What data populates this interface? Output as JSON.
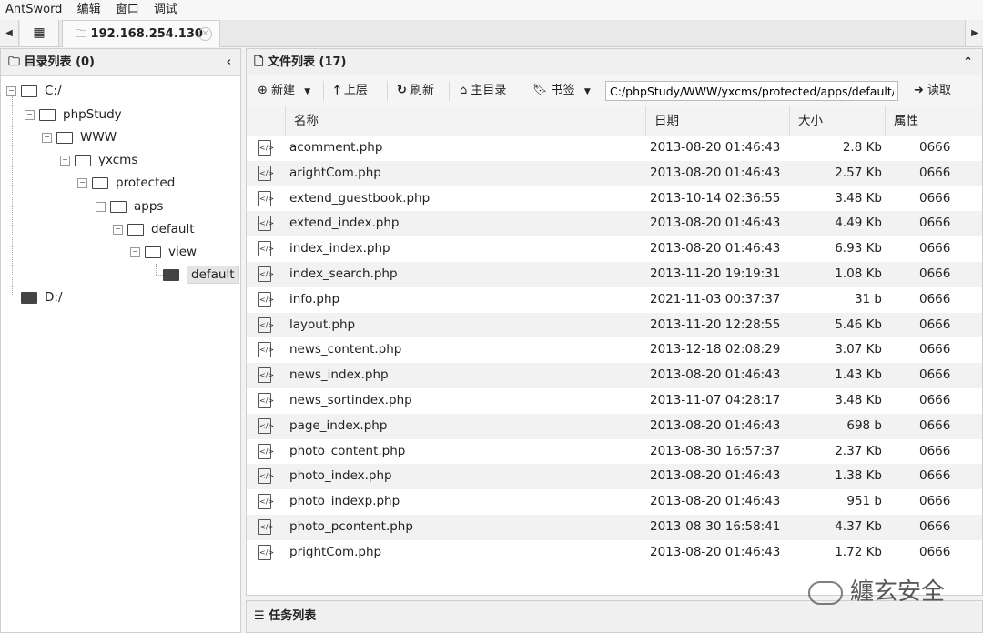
{
  "menubar": [
    "AntSword",
    "编辑",
    "窗口",
    "调试"
  ],
  "tabs": {
    "grid_icon": "grid-icon",
    "host": "192.168.254.130"
  },
  "dir_panel": {
    "title": "目录列表 (0)"
  },
  "tree": [
    {
      "label": "C:/"
    },
    {
      "label": "phpStudy"
    },
    {
      "label": "WWW"
    },
    {
      "label": "yxcms"
    },
    {
      "label": "protected"
    },
    {
      "label": "apps"
    },
    {
      "label": "default"
    },
    {
      "label": "view"
    },
    {
      "label": "default"
    },
    {
      "label": "D:/"
    }
  ],
  "file_panel": {
    "title": "文件列表 (17)"
  },
  "toolbar": {
    "new_label": "新建",
    "up_label": "上层",
    "refresh_label": "刷新",
    "home_label": "主目录",
    "bookmark_label": "书签",
    "path": "C:/phpStudy/WWW/yxcms/protected/apps/default/view/default/",
    "read_label": "读取"
  },
  "columns": [
    "名称",
    "日期",
    "大小",
    "属性"
  ],
  "files": [
    {
      "name": "acomment.php",
      "date": "2013-08-20 01:46:43",
      "size": "2.8 Kb",
      "perm": "0666"
    },
    {
      "name": "arightCom.php",
      "date": "2013-08-20 01:46:43",
      "size": "2.57 Kb",
      "perm": "0666"
    },
    {
      "name": "extend_guestbook.php",
      "date": "2013-10-14 02:36:55",
      "size": "3.48 Kb",
      "perm": "0666"
    },
    {
      "name": "extend_index.php",
      "date": "2013-08-20 01:46:43",
      "size": "4.49 Kb",
      "perm": "0666"
    },
    {
      "name": "index_index.php",
      "date": "2013-08-20 01:46:43",
      "size": "6.93 Kb",
      "perm": "0666"
    },
    {
      "name": "index_search.php",
      "date": "2013-11-20 19:19:31",
      "size": "1.08 Kb",
      "perm": "0666"
    },
    {
      "name": "info.php",
      "date": "2021-11-03 00:37:37",
      "size": "31 b",
      "perm": "0666"
    },
    {
      "name": "layout.php",
      "date": "2013-11-20 12:28:55",
      "size": "5.46 Kb",
      "perm": "0666"
    },
    {
      "name": "news_content.php",
      "date": "2013-12-18 02:08:29",
      "size": "3.07 Kb",
      "perm": "0666"
    },
    {
      "name": "news_index.php",
      "date": "2013-08-20 01:46:43",
      "size": "1.43 Kb",
      "perm": "0666"
    },
    {
      "name": "news_sortindex.php",
      "date": "2013-11-07 04:28:17",
      "size": "3.48 Kb",
      "perm": "0666"
    },
    {
      "name": "page_index.php",
      "date": "2013-08-20 01:46:43",
      "size": "698 b",
      "perm": "0666"
    },
    {
      "name": "photo_content.php",
      "date": "2013-08-30 16:57:37",
      "size": "2.37 Kb",
      "perm": "0666"
    },
    {
      "name": "photo_index.php",
      "date": "2013-08-20 01:46:43",
      "size": "1.38 Kb",
      "perm": "0666"
    },
    {
      "name": "photo_indexp.php",
      "date": "2013-08-20 01:46:43",
      "size": "951 b",
      "perm": "0666"
    },
    {
      "name": "photo_pcontent.php",
      "date": "2013-08-30 16:58:41",
      "size": "4.37 Kb",
      "perm": "0666"
    },
    {
      "name": "prightCom.php",
      "date": "2013-08-20 01:46:43",
      "size": "1.72 Kb",
      "perm": "0666"
    }
  ],
  "task_panel": {
    "title": "任务列表"
  },
  "watermark": "纏玄安全"
}
